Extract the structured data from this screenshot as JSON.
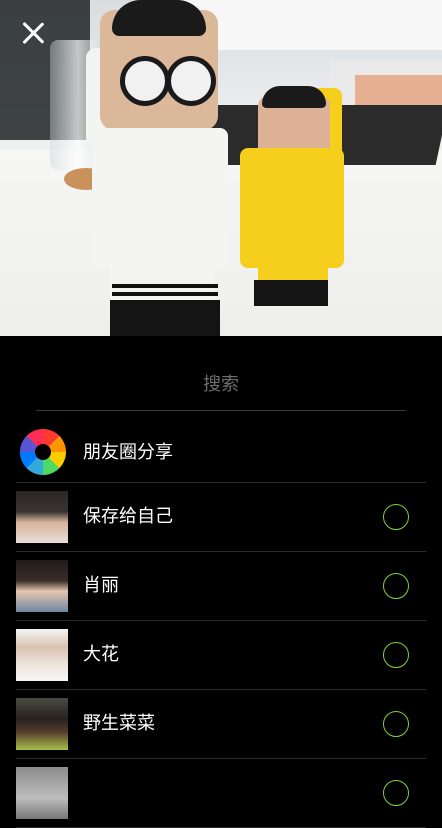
{
  "header": {
    "close_icon": "close-icon"
  },
  "search": {
    "placeholder": "搜索"
  },
  "share_options": [
    {
      "label": "朋友圈分享",
      "icon": "moments-icon"
    }
  ],
  "contacts": [
    {
      "name": "保存给自己",
      "selected": false
    },
    {
      "name": "肖丽",
      "selected": false
    },
    {
      "name": "大花",
      "selected": false
    },
    {
      "name": "野生菜菜",
      "selected": false
    },
    {
      "name": "",
      "selected": false
    }
  ],
  "colors": {
    "accent_check": "#7bd335",
    "background": "#000000"
  }
}
